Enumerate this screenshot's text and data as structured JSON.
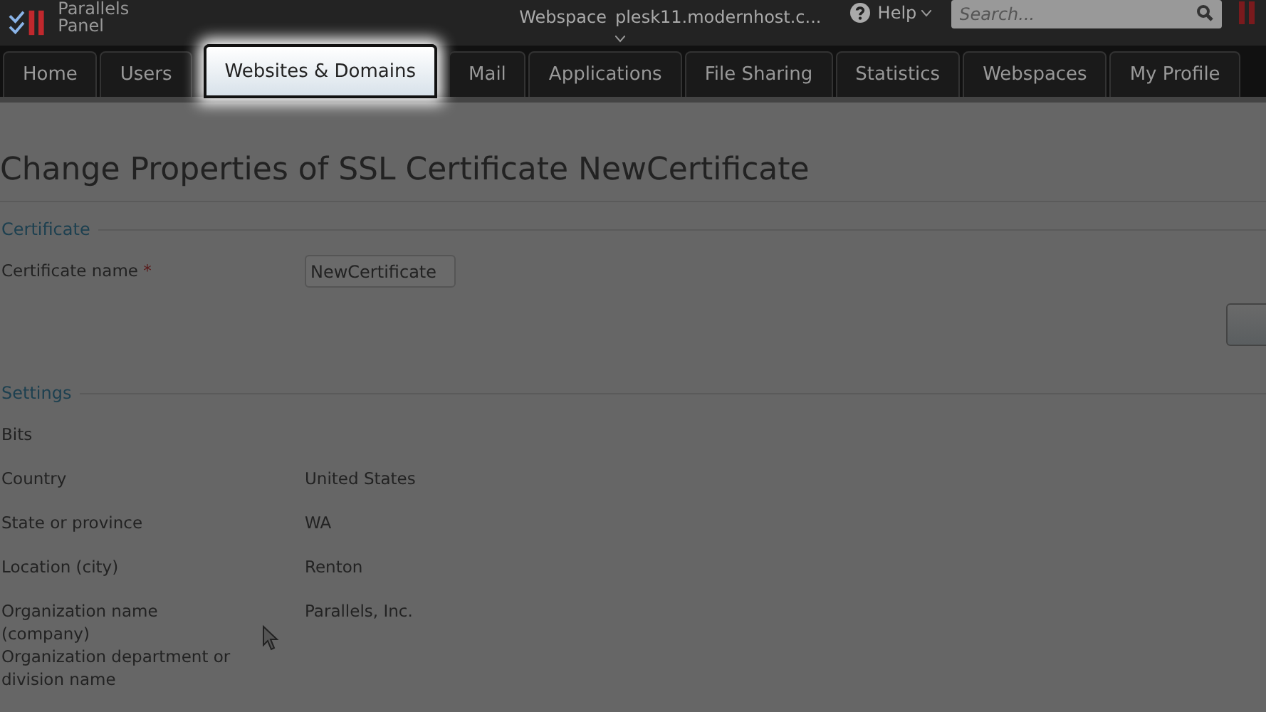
{
  "header": {
    "logo": [
      "Parallels",
      "Panel"
    ],
    "webspace_label": "Webspace",
    "webspace_value": "plesk11.modernhost.c...",
    "help": "Help",
    "search": {
      "placeholder": "Search..."
    }
  },
  "tabs": [
    {
      "label": "Home",
      "selected": false
    },
    {
      "label": "Users",
      "selected": false
    },
    {
      "label": "Websites & Domains",
      "selected": true
    },
    {
      "label": "Mail",
      "selected": false
    },
    {
      "label": "Applications",
      "selected": false
    },
    {
      "label": "File Sharing",
      "selected": false
    },
    {
      "label": "Statistics",
      "selected": false
    },
    {
      "label": "Webspaces",
      "selected": false
    },
    {
      "label": "My Profile",
      "selected": false
    }
  ],
  "page_title": "Change Properties of SSL Certificate NewCertificate",
  "certificate": {
    "heading": "Certificate",
    "name_label": "Certificate name",
    "required_mark": "*",
    "name_value": "NewCertificate"
  },
  "settings": {
    "heading": "Settings",
    "rows": [
      {
        "label": "Bits",
        "value": ""
      },
      {
        "label": "Country",
        "value": "United States"
      },
      {
        "label": "State or province",
        "value": "WA"
      },
      {
        "label": "Location (city)",
        "value": "Renton"
      },
      {
        "label": "Organization name (company)",
        "value": "Parallels, Inc."
      },
      {
        "label": "Organization department or division name",
        "value": ""
      }
    ]
  }
}
